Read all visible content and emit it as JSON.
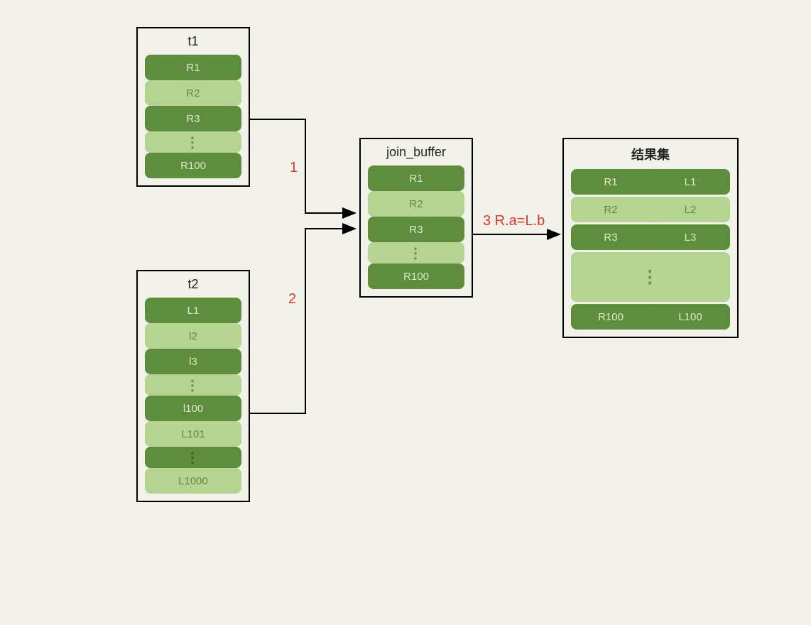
{
  "boxes": {
    "t1": {
      "title": "t1",
      "rows": [
        "R1",
        "R2",
        "R3",
        "⋮",
        "R100"
      ]
    },
    "t2": {
      "title": "t2",
      "rows": [
        "L1",
        "l2",
        "l3",
        "⋮",
        "l100",
        "L101",
        "⋮",
        "L1000"
      ]
    },
    "join_buffer": {
      "title": "join_buffer",
      "rows": [
        "R1",
        "R2",
        "R3",
        "⋮",
        "R100"
      ]
    },
    "result": {
      "title": "结果集",
      "pairs": [
        [
          "R1",
          "L1"
        ],
        [
          "R2",
          "L2"
        ],
        [
          "R3",
          "L3"
        ]
      ],
      "dots": "⋮",
      "last_pair": [
        "R100",
        "L100"
      ]
    }
  },
  "edges": {
    "e1": {
      "label": "1"
    },
    "e2": {
      "label": "2"
    },
    "e3": {
      "label": "3 R.a=L.b"
    }
  },
  "colors": {
    "dark_green": "#5f8d3e",
    "light_green": "#b5d491",
    "red": "#d9362b",
    "bg": "#f2f2ea"
  }
}
